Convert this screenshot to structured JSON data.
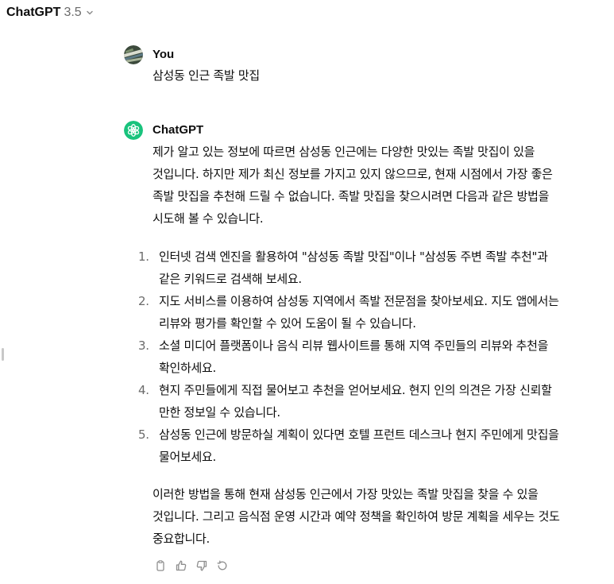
{
  "header": {
    "model_name": "ChatGPT",
    "model_version": "3.5"
  },
  "conversation": {
    "user_message": {
      "author": "You",
      "text": "삼성동 인근 족발 맛집"
    },
    "assistant_message": {
      "author": "ChatGPT",
      "intro": "제가 알고 있는 정보에 따르면 삼성동 인근에는 다양한 맛있는 족발 맛집이 있을 것입니다. 하지만 제가 최신 정보를 가지고 있지 않으므로, 현재 시점에서 가장 좋은 족발 맛집을 추천해 드릴 수 없습니다. 족발 맛집을 찾으시려면 다음과 같은 방법을 시도해 볼 수 있습니다.",
      "steps": [
        {
          "num": "1.",
          "text": "인터넷 검색 엔진을 활용하여 \"삼성동 족발 맛집\"이나 \"삼성동 주변 족발 추천\"과 같은 키워드로 검색해 보세요."
        },
        {
          "num": "2.",
          "text": "지도 서비스를 이용하여 삼성동 지역에서 족발 전문점을 찾아보세요. 지도 앱에서는 리뷰와 평가를 확인할 수 있어 도움이 될 수 있습니다."
        },
        {
          "num": "3.",
          "text": "소셜 미디어 플랫폼이나 음식 리뷰 웹사이트를 통해 지역 주민들의 리뷰와 추천을 확인하세요."
        },
        {
          "num": "4.",
          "text": "현지 주민들에게 직접 물어보고 추천을 얻어보세요. 현지 인의 의견은 가장 신뢰할 만한 정보일 수 있습니다."
        },
        {
          "num": "5.",
          "text": "삼성동 인근에 방문하실 계획이 있다면 호텔 프런트 데스크나 현지 주민에게 맛집을 물어보세요."
        }
      ],
      "outro": "이러한 방법을 통해 현재 삼성동 인근에서 가장 맛있는 족발 맛집을 찾을 수 있을 것입니다. 그리고 음식점 운영 시간과 예약 정책을 확인하여 방문 계획을 세우는 것도 중요합니다."
    },
    "actions": [
      {
        "name": "copy-icon"
      },
      {
        "name": "thumbs-up-icon"
      },
      {
        "name": "thumbs-down-icon"
      },
      {
        "name": "regenerate-icon"
      }
    ]
  },
  "colors": {
    "brand": "#19c37d",
    "text": "#0d0d0d",
    "muted": "#6b6b6b"
  }
}
